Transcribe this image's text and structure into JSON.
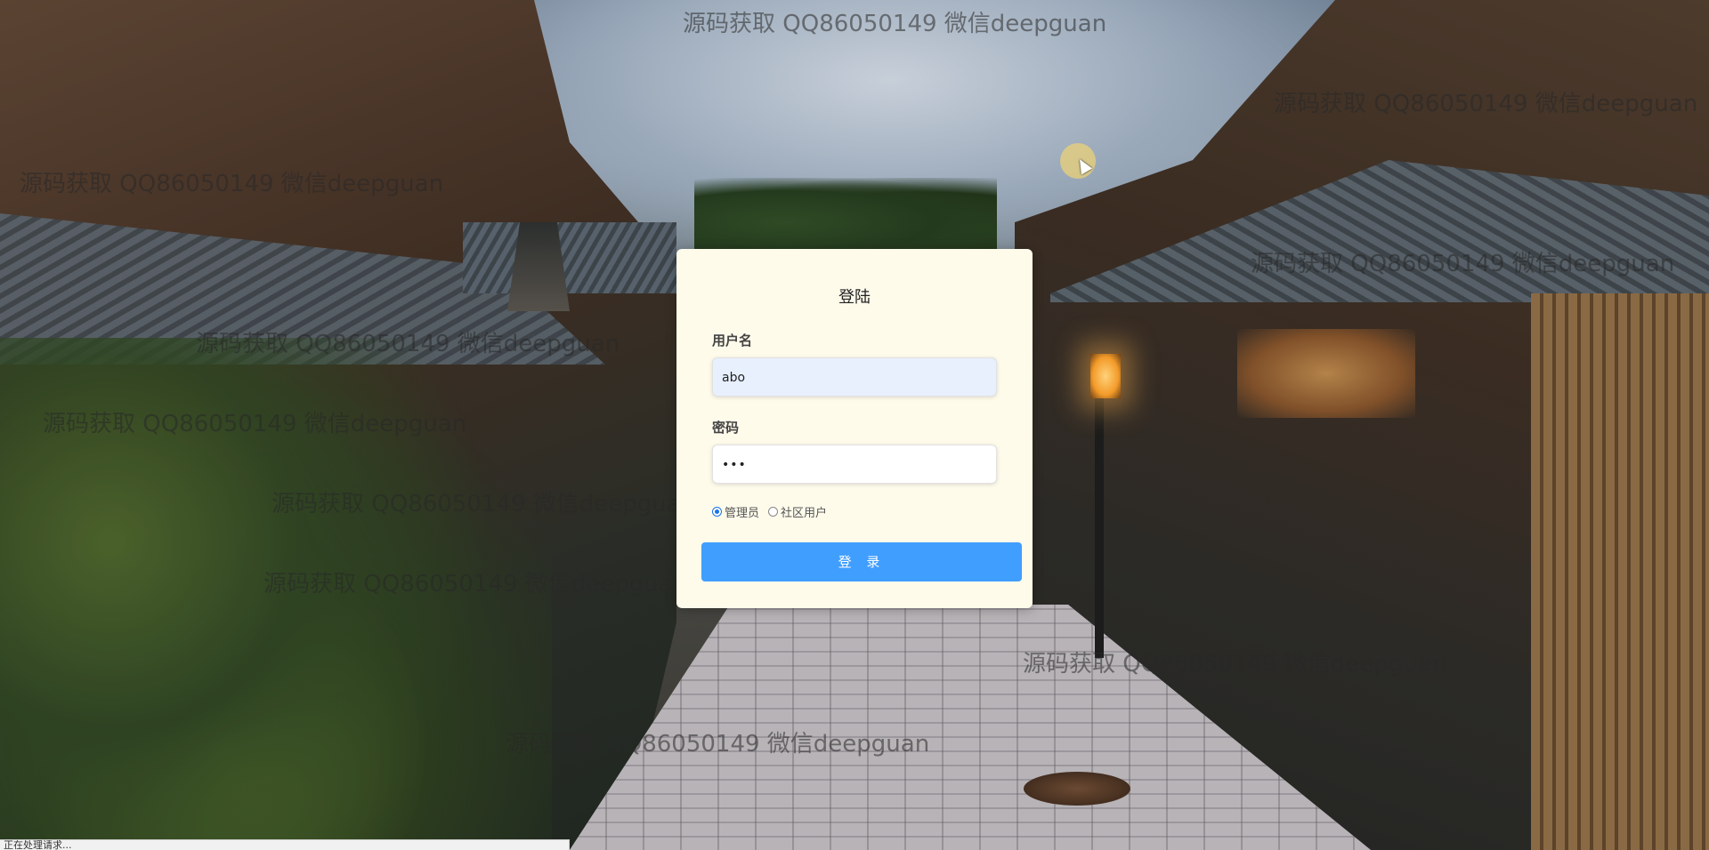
{
  "login": {
    "title": "登陆",
    "username_label": "用户名",
    "username_value": "abo",
    "password_label": "密码",
    "password_value": "•••",
    "roles": [
      {
        "label": "管理员",
        "checked": true
      },
      {
        "label": "社区用户",
        "checked": false
      }
    ],
    "submit_label": "登 录"
  },
  "watermarks": [
    "源码获取 QQ86050149 微信deepguan",
    "源码获取 QQ86050149 微信deepguan",
    "源码获取 QQ86050149 微信deepguan",
    "源码获取 QQ86050149 微信deepguan",
    "源码获取 QQ86050149 微信deepguan",
    "源码获取 QQ86050149 微信deepguan",
    "源码获取 QQ86050149 微信deepguan",
    "源码获取 QQ86050149 微信deepguan",
    "源码获取 QQ86050149 微信deepguan",
    "源码获取 QQ86050149 微信deepguan"
  ],
  "status_bar": {
    "text": "正在处理请求..."
  },
  "colors": {
    "card_bg": "#fefbeb",
    "button_bg": "#409eff",
    "autofill_bg": "#e8f0fe"
  }
}
